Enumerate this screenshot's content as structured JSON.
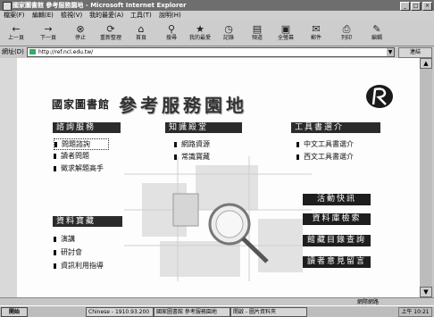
{
  "window": {
    "title": "國家圖書館 參考服務園地 - Microsoft Internet Explorer",
    "minimize": "_",
    "maximize": "□",
    "close": "×"
  },
  "menu": [
    "檔案(F)",
    "編輯(E)",
    "檢視(V)",
    "我的最愛(A)",
    "工具(T)",
    "說明(H)"
  ],
  "toolbar": [
    {
      "label": "上一頁",
      "icon": "back-arrow-icon",
      "glyph": "←"
    },
    {
      "label": "下一頁",
      "icon": "forward-arrow-icon",
      "glyph": "→"
    },
    {
      "label": "停止",
      "icon": "stop-icon",
      "glyph": "⊗"
    },
    {
      "label": "重新整理",
      "icon": "refresh-icon",
      "glyph": "⟳"
    },
    {
      "label": "首頁",
      "icon": "home-icon",
      "glyph": "⌂"
    },
    {
      "label": "搜尋",
      "icon": "search-icon",
      "glyph": "⚲"
    },
    {
      "label": "我的最愛",
      "icon": "favorites-icon",
      "glyph": "★"
    },
    {
      "label": "記錄",
      "icon": "history-icon",
      "glyph": "◷"
    },
    {
      "label": "頻道",
      "icon": "channels-icon",
      "glyph": "▤"
    },
    {
      "label": "全螢幕",
      "icon": "fullscreen-icon",
      "glyph": "▣"
    },
    {
      "label": "郵件",
      "icon": "mail-icon",
      "glyph": "✉"
    },
    {
      "label": "列印",
      "icon": "print-icon",
      "glyph": "⎙"
    },
    {
      "label": "編輯",
      "icon": "edit-icon",
      "glyph": "✎"
    }
  ],
  "address": {
    "label": "網址(D)",
    "value": "http://ref.ncl.edu.tw/",
    "go": "連結"
  },
  "page": {
    "logo_text": "國家圖書館",
    "title": "參考服務園地",
    "sections": {
      "consult": {
        "header": "諮詢服務",
        "links": [
          "問題諮詢",
          "讀者問題",
          "徵求解題高手"
        ]
      },
      "knowledge": {
        "header": "知識殿堂",
        "links": [
          "網路資源",
          "常識寶藏"
        ]
      },
      "tools": {
        "header": "工具書選介",
        "links": [
          "中文工具書選介",
          "西文工具書選介"
        ]
      },
      "mine": {
        "header": "資料寶藏",
        "links": [
          "演講",
          "研討會",
          "資訊利用指導"
        ]
      }
    },
    "right_buttons": [
      "活動快訊",
      "資料庫檢索",
      "館藏目錄查詢",
      "讀者意見留言"
    ]
  },
  "status": {
    "zone": "網際網路"
  },
  "taskbar": {
    "start": "開始",
    "tasks": [
      "Chinese - 1910.93.200",
      "國家圖書館 參考服務園地",
      "開啟 - 圖片資料夾"
    ],
    "clock": "上午 10:21"
  }
}
